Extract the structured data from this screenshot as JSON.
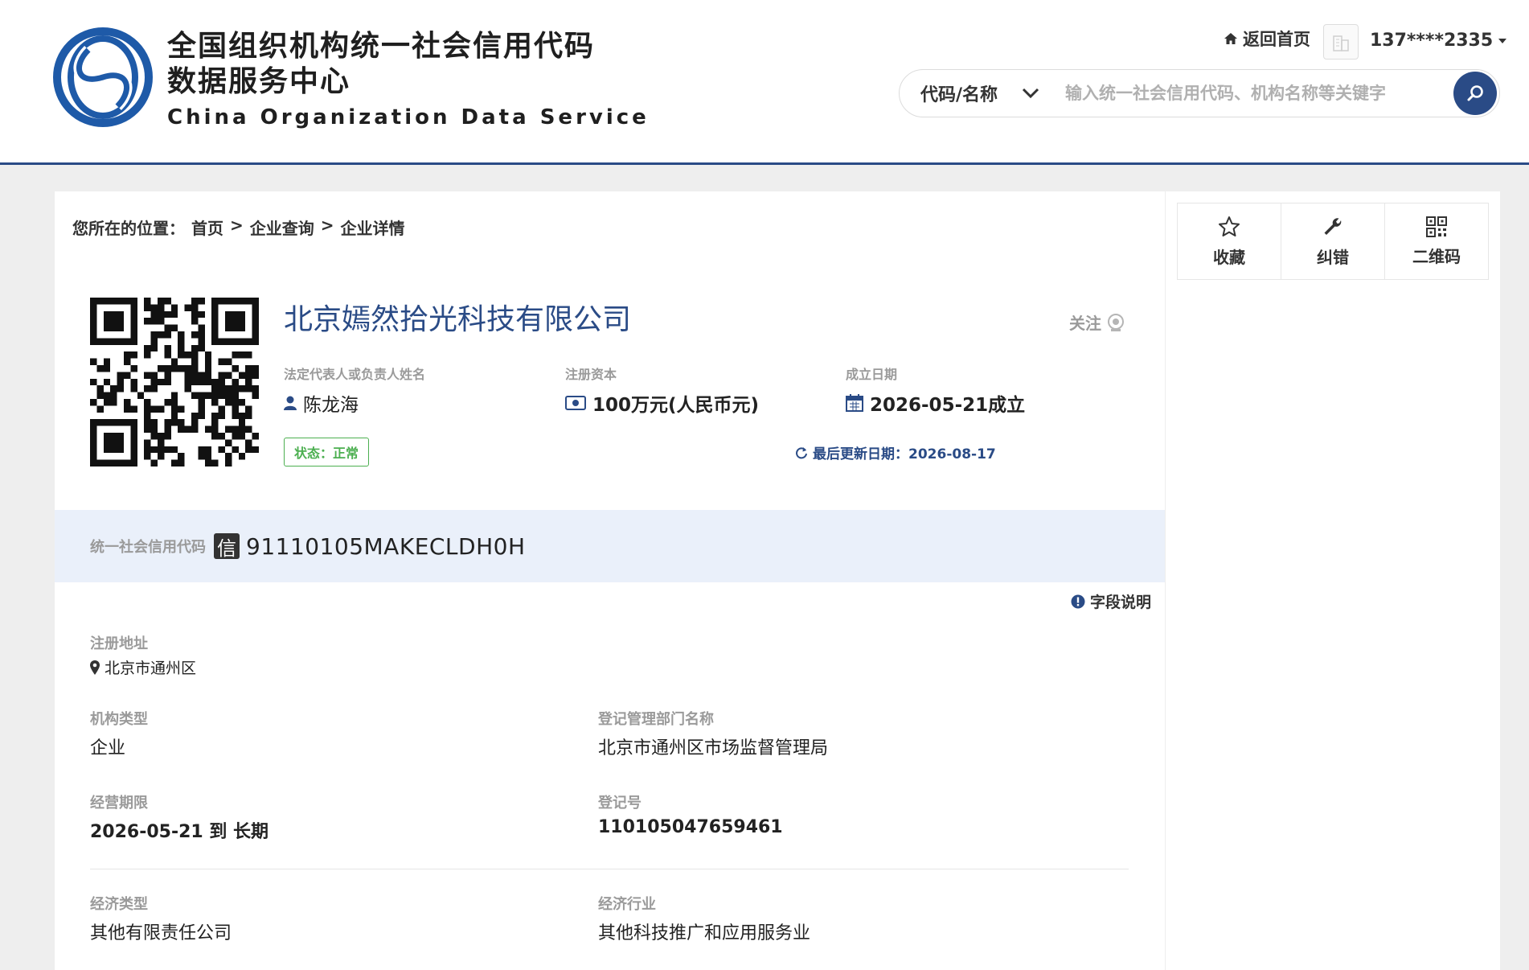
{
  "header": {
    "logo_cn_line1": "全国组织机构统一社会信用代码",
    "logo_cn_line2": "数据服务中心",
    "logo_en": "China Organization Data Service",
    "home_link": "返回首页",
    "user_name": "137****2335",
    "search": {
      "type_selected": "代码/名称",
      "placeholder": "输入统一社会信用代码、机构名称等关键字"
    },
    "colors": {
      "brand": "#2a4b86"
    }
  },
  "breadcrumb": {
    "prefix": "您所在的位置：",
    "items": [
      "首页",
      "企业查询",
      "企业详情"
    ],
    "separator": ">"
  },
  "company": {
    "name": "北京嫣然拾光科技有限公司",
    "follow_label": "关注",
    "legal_rep_label": "法定代表人或负责人姓名",
    "legal_rep": "陈龙海",
    "capital_label": "注册资本",
    "capital": "100万元(人民币元)",
    "founded_label": "成立日期",
    "founded": "2026-05-21成立",
    "status": "状态：正常",
    "last_update": "最后更新日期：2026-08-17",
    "credit_label": "统一社会信用代码",
    "credit_icon": "信",
    "credit_code": "91110105MAKECLDH0H",
    "field_help": "字段说明"
  },
  "fields": {
    "address_label": "注册地址",
    "address": "北京市通州区",
    "org_type_label": "机构类型",
    "org_type": "企业",
    "reg_dept_label": "登记管理部门名称",
    "reg_dept": "北京市通州区市场监督管理局",
    "term_label": "经营期限",
    "term": "2026-05-21 到 长期",
    "reg_no_label": "登记号",
    "reg_no": "110105047659461",
    "econ_type_label": "经济类型",
    "econ_type": "其他有限责任公司",
    "industry_label": "经济行业",
    "industry": "其他科技推广和应用服务业"
  },
  "side": {
    "actions": [
      {
        "label": "收藏",
        "icon": "star-icon"
      },
      {
        "label": "纠错",
        "icon": "wrench-icon"
      },
      {
        "label": "二维码",
        "icon": "qrcode-icon"
      }
    ]
  }
}
